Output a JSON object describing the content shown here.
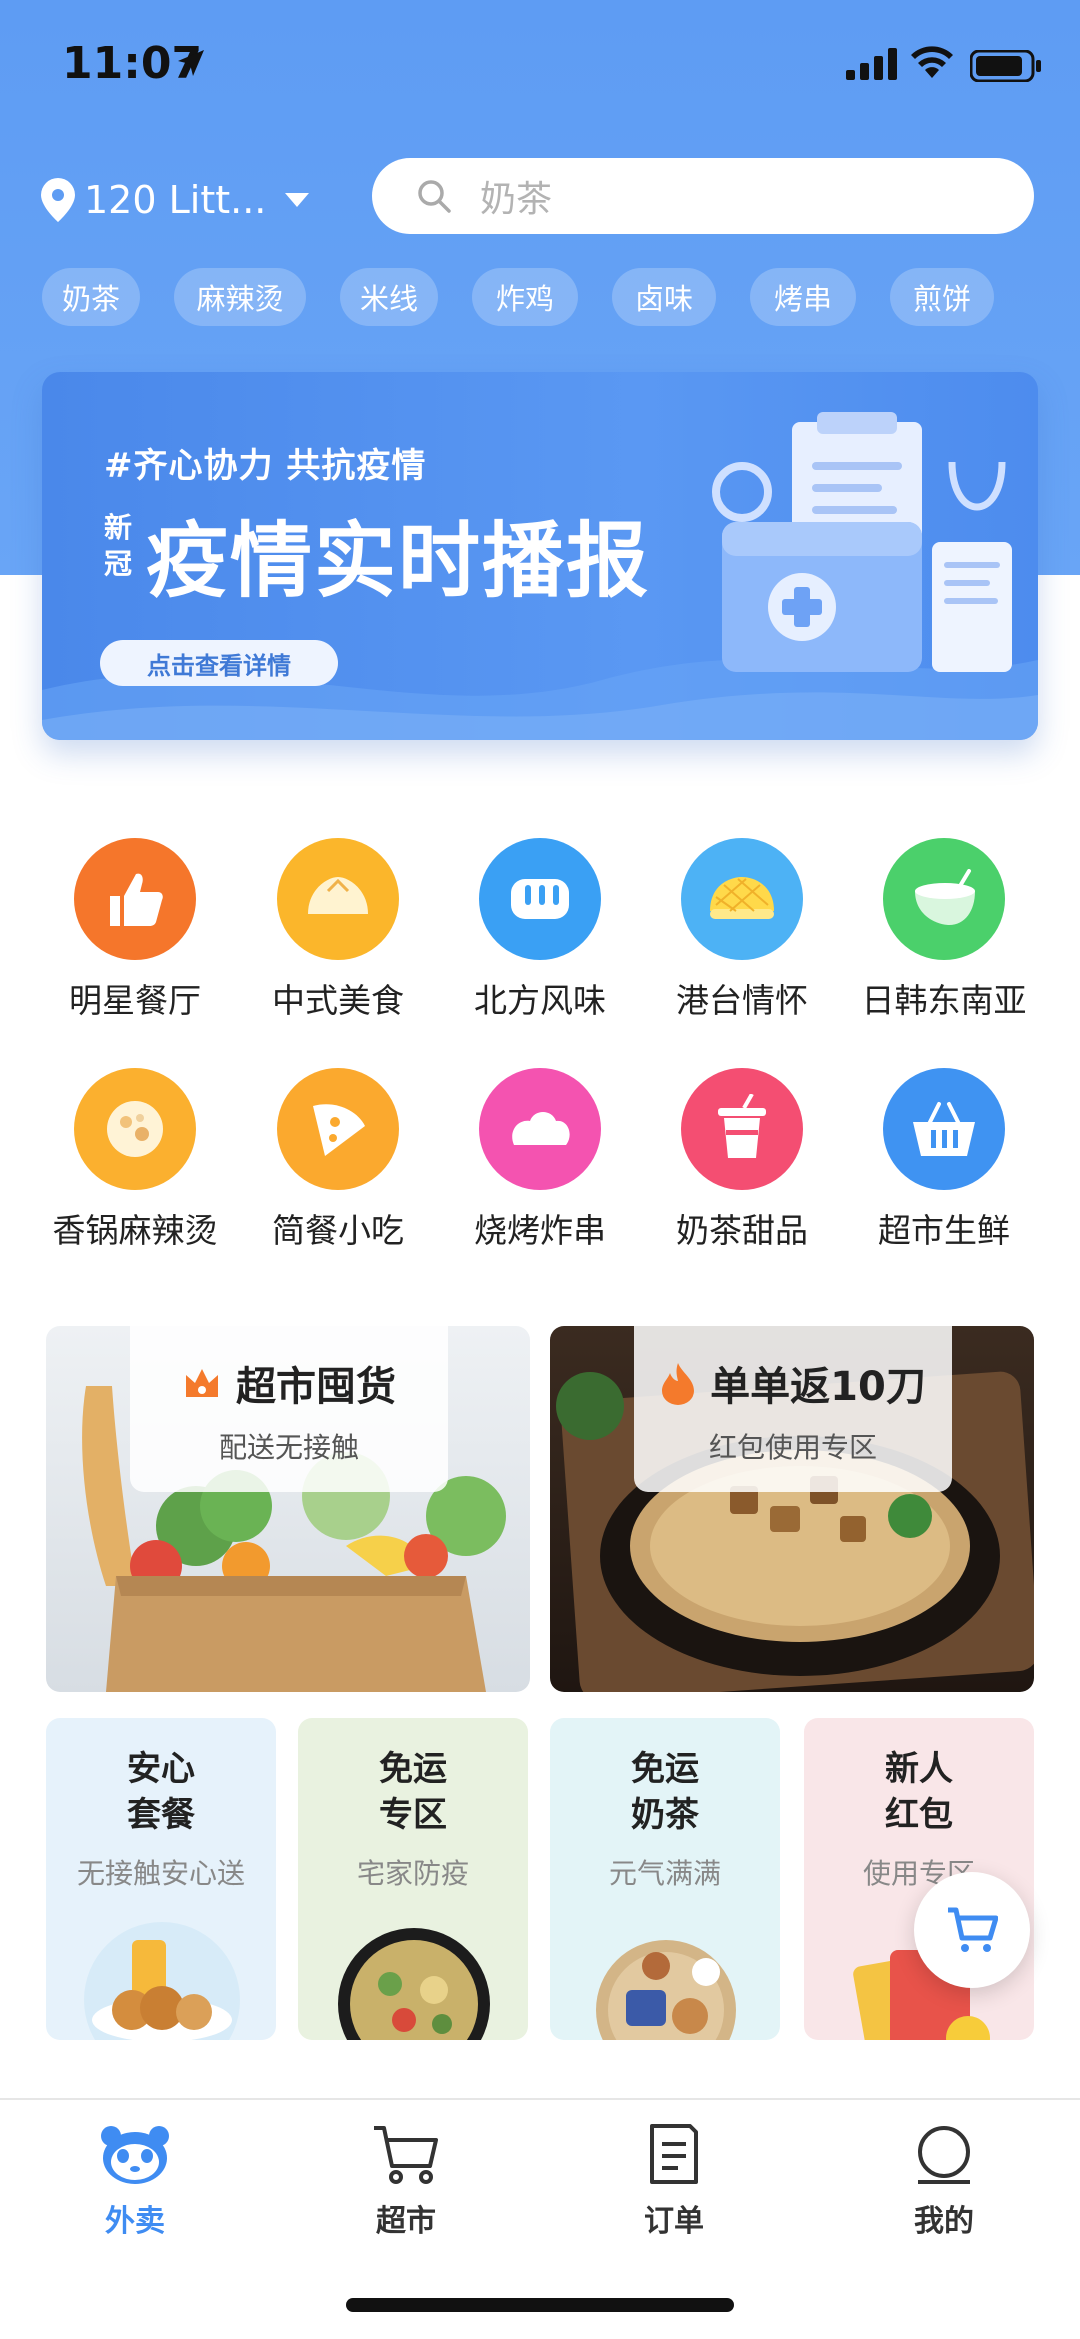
{
  "status_bar": {
    "time": "11:07"
  },
  "header": {
    "location": "120 Litt...",
    "search_placeholder": "奶茶",
    "tags": [
      "奶茶",
      "麻辣烫",
      "米线",
      "炸鸡",
      "卤味",
      "烤串",
      "煎饼"
    ]
  },
  "banner": {
    "hashtag": "#齐心协力  共抗疫情",
    "badge": "新冠",
    "title": "疫情实时播报",
    "cta": "点击查看详情"
  },
  "categories": [
    {
      "label": "明星餐厅",
      "icon": "thumbs-up-icon",
      "color": "#f5762b"
    },
    {
      "label": "中式美食",
      "icon": "steamed-bun-icon",
      "color": "#fbb62b"
    },
    {
      "label": "北方风味",
      "icon": "bread-icon",
      "color": "#3aa0f4"
    },
    {
      "label": "港台情怀",
      "icon": "pineapple-bun-icon",
      "color": "#4db2f5"
    },
    {
      "label": "日韩东南亚",
      "icon": "coconut-icon",
      "color": "#4bd06b"
    },
    {
      "label": "香锅麻辣烫",
      "icon": "hot-pot-icon",
      "color": "#fbb02f"
    },
    {
      "label": "简餐小吃",
      "icon": "pizza-slice-icon",
      "color": "#fba92e"
    },
    {
      "label": "烧烤炸串",
      "icon": "roast-chicken-icon",
      "color": "#f453b0"
    },
    {
      "label": "奶茶甜品",
      "icon": "milk-tea-cup-icon",
      "color": "#f44e72"
    },
    {
      "label": "超市生鲜",
      "icon": "basket-icon",
      "color": "#3f93f2"
    }
  ],
  "promos": [
    {
      "title": "超市囤货",
      "subtitle": "配送无接触",
      "icon": "crown-icon"
    },
    {
      "title": "单单返10刀",
      "subtitle": "红包使用专区",
      "icon": "flame-icon"
    }
  ],
  "mini_cards": [
    {
      "line1": "安心",
      "line2": "套餐",
      "subtitle": "无接触安心送",
      "bg": "#e6f2fb"
    },
    {
      "line1": "免运",
      "line2": "专区",
      "subtitle": "宅家防疫",
      "bg": "#e9f2e0"
    },
    {
      "line1": "免运",
      "line2": "奶茶",
      "subtitle": "元气满满",
      "bg": "#e3f4f7"
    },
    {
      "line1": "新人",
      "line2": "红包",
      "subtitle": "使用专区",
      "bg": "#f9e6e8"
    }
  ],
  "tabbar": [
    {
      "label": "外卖",
      "icon": "panda-icon",
      "active": true
    },
    {
      "label": "超市",
      "icon": "cart-icon",
      "active": false
    },
    {
      "label": "订单",
      "icon": "document-icon",
      "active": false
    },
    {
      "label": "我的",
      "icon": "profile-icon",
      "active": false
    }
  ]
}
